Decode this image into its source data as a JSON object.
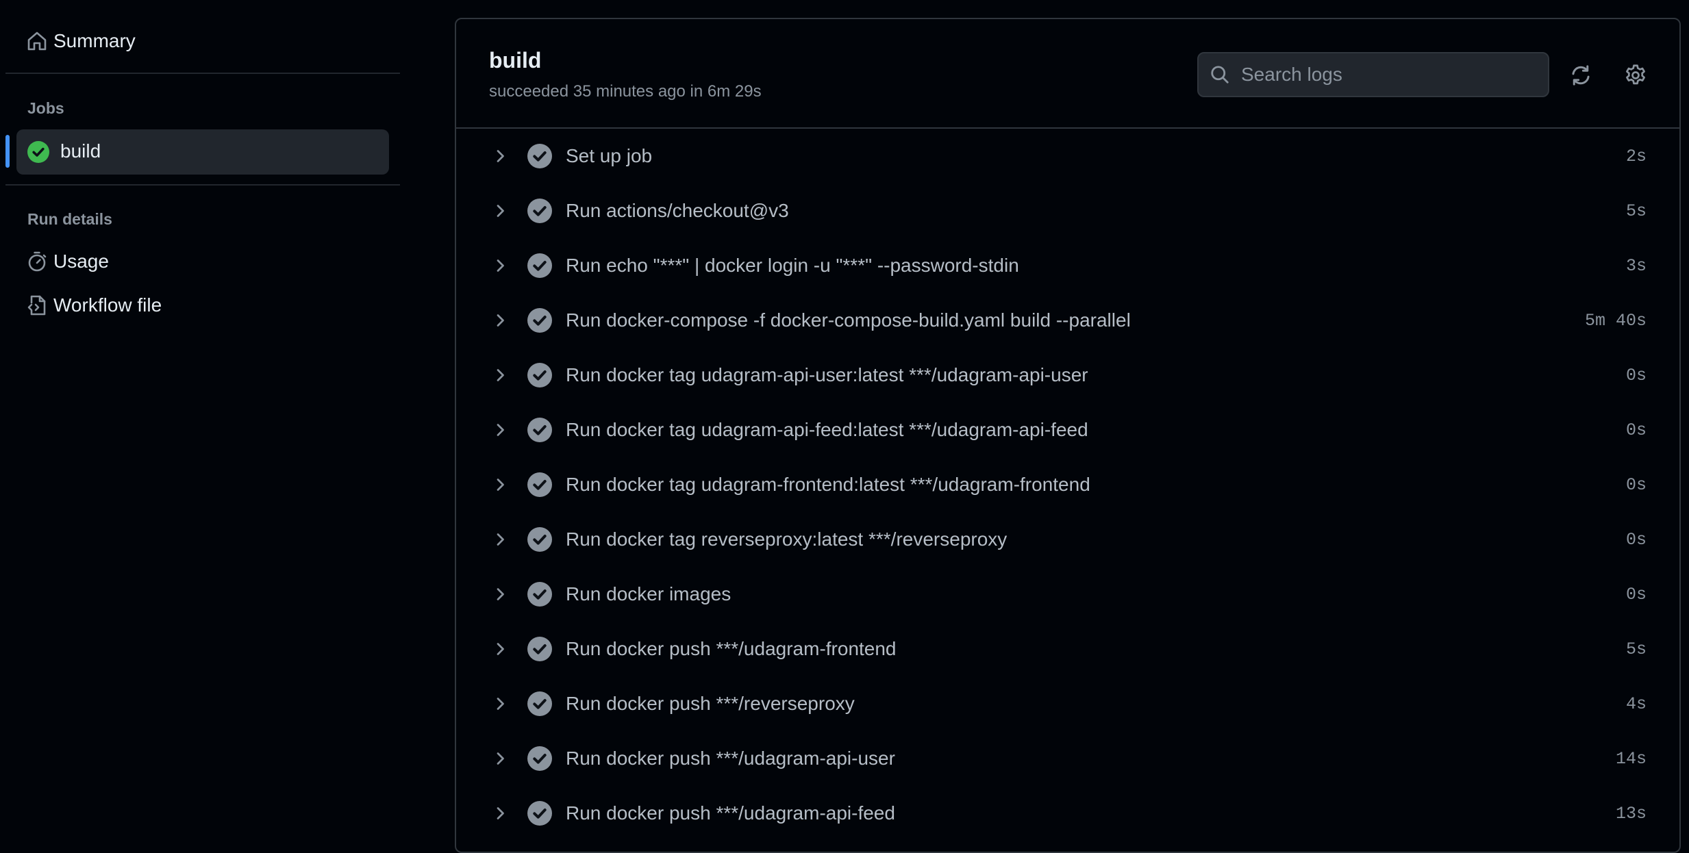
{
  "sidebar": {
    "summary_label": "Summary",
    "jobs_title": "Jobs",
    "job": {
      "label": "build",
      "status": "success"
    },
    "run_details_title": "Run details",
    "usage_label": "Usage",
    "workflow_file_label": "Workflow file"
  },
  "job": {
    "title": "build",
    "status_text": "succeeded 35 minutes ago in 6m 29s"
  },
  "search": {
    "placeholder": "Search logs"
  },
  "steps": [
    {
      "name": "Set up job",
      "duration": "2s"
    },
    {
      "name": "Run actions/checkout@v3",
      "duration": "5s"
    },
    {
      "name": "Run echo \"***\" | docker login -u \"***\" --password-stdin",
      "duration": "3s"
    },
    {
      "name": "Run docker-compose -f docker-compose-build.yaml build --parallel",
      "duration": "5m 40s"
    },
    {
      "name": "Run docker tag udagram-api-user:latest ***/udagram-api-user",
      "duration": "0s"
    },
    {
      "name": "Run docker tag udagram-api-feed:latest ***/udagram-api-feed",
      "duration": "0s"
    },
    {
      "name": "Run docker tag udagram-frontend:latest ***/udagram-frontend",
      "duration": "0s"
    },
    {
      "name": "Run docker tag reverseproxy:latest ***/reverseproxy",
      "duration": "0s"
    },
    {
      "name": "Run docker images",
      "duration": "0s"
    },
    {
      "name": "Run docker push ***/udagram-frontend",
      "duration": "5s"
    },
    {
      "name": "Run docker push ***/reverseproxy",
      "duration": "4s"
    },
    {
      "name": "Run docker push ***/udagram-api-user",
      "duration": "14s"
    },
    {
      "name": "Run docker push ***/udagram-api-feed",
      "duration": "13s"
    }
  ],
  "colors": {
    "success": "#3fb950",
    "accent": "#4493f8",
    "step_check": "#8b949e"
  }
}
